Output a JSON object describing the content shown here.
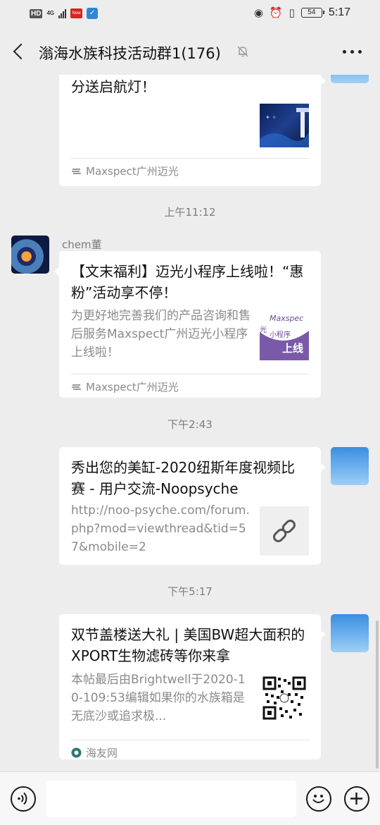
{
  "status_bar": {
    "hd": "HD",
    "network": "4G",
    "battery": "54",
    "time": "5:17"
  },
  "header": {
    "title": "滃海水族科技活动群1(176)"
  },
  "messages": [
    {
      "type": "card",
      "title": "分送启航灯！",
      "source": "Maxspect广州迈光"
    },
    {
      "type": "timestamp",
      "text": "上午11:12"
    },
    {
      "type": "card",
      "sender": "chem董",
      "title": "【文末福利】迈光小程序上线啦！“惠粉”活动享不停！",
      "description": "为更好地完善我们的产品咨询和售后服务Maxspect广州迈光小程序上线啦！",
      "thumb_text": {
        "brand": "Maxspec",
        "line1": "小程序",
        "line2": "上线",
        "prefix": "光"
      },
      "source": "Maxspect广州迈光"
    },
    {
      "type": "timestamp",
      "text": "下午2:43"
    },
    {
      "type": "card",
      "title": "秀出您的美缸-2020纽斯年度视频比赛 - 用户交流-Noopsyche",
      "description": "http://noo-psyche.com/forum.php?mod=viewthread&tid=57&mobile=2"
    },
    {
      "type": "timestamp",
      "text": "下午5:17"
    },
    {
      "type": "card",
      "title": "双节盖楼送大礼 | 美国BW超大面积的XPORT生物滤砖等你来拿",
      "description": "本帖最后由Brightwell于2020-10-109:53编辑如果你的水族箱是无底沙或追求极...",
      "source": "海友网"
    }
  ],
  "input": {
    "placeholder": ""
  },
  "colors": {
    "background": "#ededed",
    "card": "#ffffff",
    "muted_text": "#8a8a8a"
  }
}
